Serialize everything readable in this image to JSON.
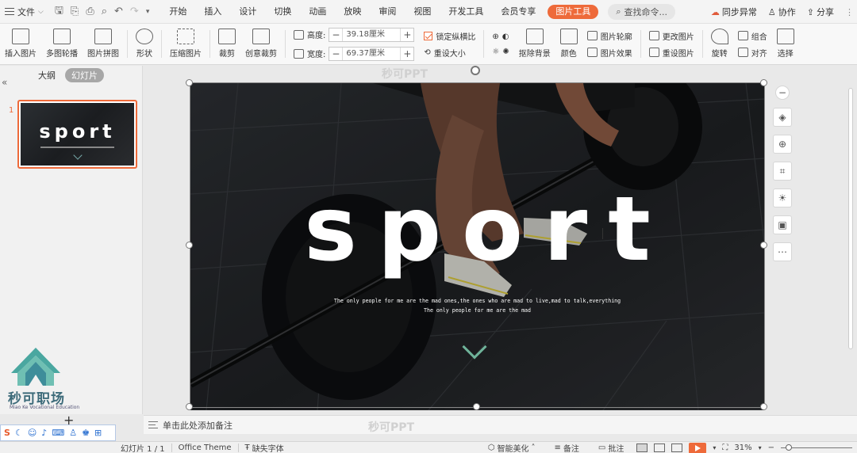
{
  "menubar": {
    "file_label": "文件",
    "tabs": [
      "开始",
      "插入",
      "设计",
      "切换",
      "动画",
      "放映",
      "审阅",
      "视图",
      "开发工具",
      "会员专享"
    ],
    "active_tab": "图片工具",
    "search_label": "查找命令...",
    "right": {
      "sync": "同步异常",
      "collab": "协作",
      "share": "分享"
    }
  },
  "ribbon": {
    "insert_picture": "插入图片",
    "multi_carousel": "多图轮播",
    "picture_collage": "图片拼图",
    "shape": "形状",
    "compress_picture": "压缩图片",
    "crop": "裁剪",
    "creative_crop": "创意裁剪",
    "height_label": "高度:",
    "height_value": "39.18厘米",
    "width_label": "宽度:",
    "width_value": "69.37厘米",
    "lock_ratio": "锁定纵横比",
    "reset_size": "重设大小",
    "remove_bg": "抠除背景",
    "color": "颜色",
    "picture_outline": "图片轮廓",
    "picture_effects": "图片效果",
    "change_picture": "更改图片",
    "reset_picture": "重设图片",
    "rotate": "旋转",
    "group": "组合",
    "align": "对齐",
    "select": "选择"
  },
  "leftpanel": {
    "outline_tab": "大纲",
    "slides_tab": "幻灯片",
    "thumb_number": "1",
    "thumb_title": "sport",
    "logo_name": "秒可职场",
    "logo_sub": "Miao Ke Vocational Education"
  },
  "slide": {
    "title": "sport",
    "subtitle1": "The only people for me are the mad ones,the ones who are mad to live,mad to talk,everything",
    "subtitle2": "The only people for me are the mad",
    "watermark": "秒可PPT"
  },
  "notes": {
    "placeholder": "单击此处添加备注",
    "watermark": "秒可PPT"
  },
  "status": {
    "slide_count": "幻灯片 1 / 1",
    "theme": "Office Theme",
    "missing_font": "缺失字体",
    "smart_beautify": "智能美化",
    "notes": "备注",
    "comments": "批注",
    "zoom": "31%"
  },
  "colors": {
    "accent": "#ee6a3a",
    "chevron": "#6fb39a"
  }
}
